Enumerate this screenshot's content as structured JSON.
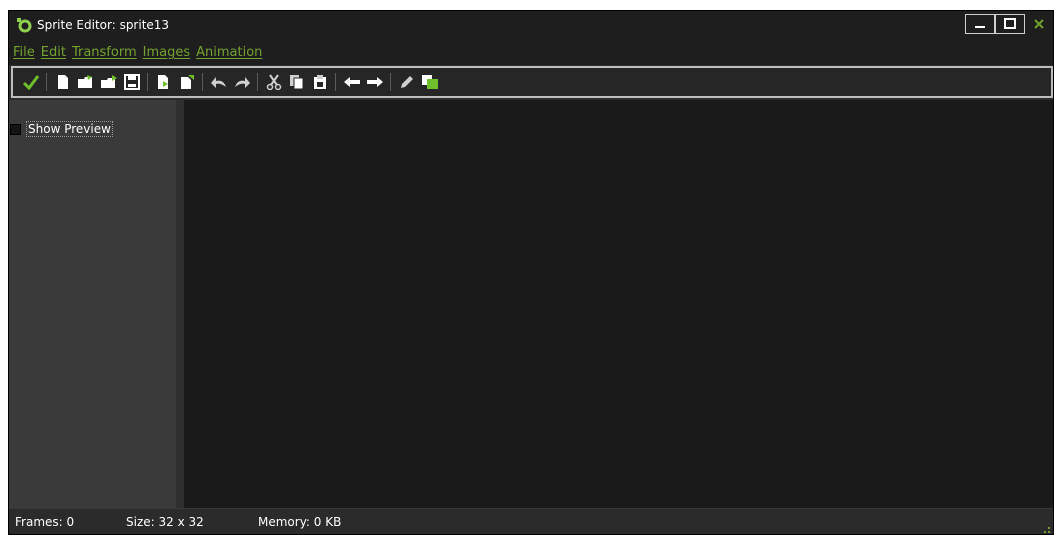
{
  "window": {
    "title": "Sprite Editor: sprite13",
    "logo_icon": "gamemaker-logo-icon",
    "controls": [
      "minimize-icon",
      "maximize-icon",
      "close-icon"
    ]
  },
  "menu": {
    "items": [
      "File",
      "Edit",
      "Transform",
      "Images",
      "Animation"
    ]
  },
  "toolbar": {
    "buttons": [
      "confirm-icon",
      "new-icon",
      "open-icon",
      "open-folder-icon",
      "save-icon",
      "import-icon",
      "export-icon",
      "undo-icon",
      "redo-icon",
      "cut-icon",
      "copy-icon",
      "paste-icon",
      "shift-left-icon",
      "shift-right-icon",
      "edit-pencil-icon",
      "color-layers-icon"
    ]
  },
  "left_panel": {
    "show_preview_label": "Show Preview",
    "show_preview_checked": false
  },
  "status": {
    "frames": "Frames: 0",
    "size": "Size: 32 x 32",
    "memory": "Memory: 0 KB"
  },
  "colors": {
    "accent_green": "#74a22e",
    "title_bg": "#1e1e1e",
    "canvas_bg": "#1a1a1a",
    "panel_bg": "#3a3a3a"
  }
}
